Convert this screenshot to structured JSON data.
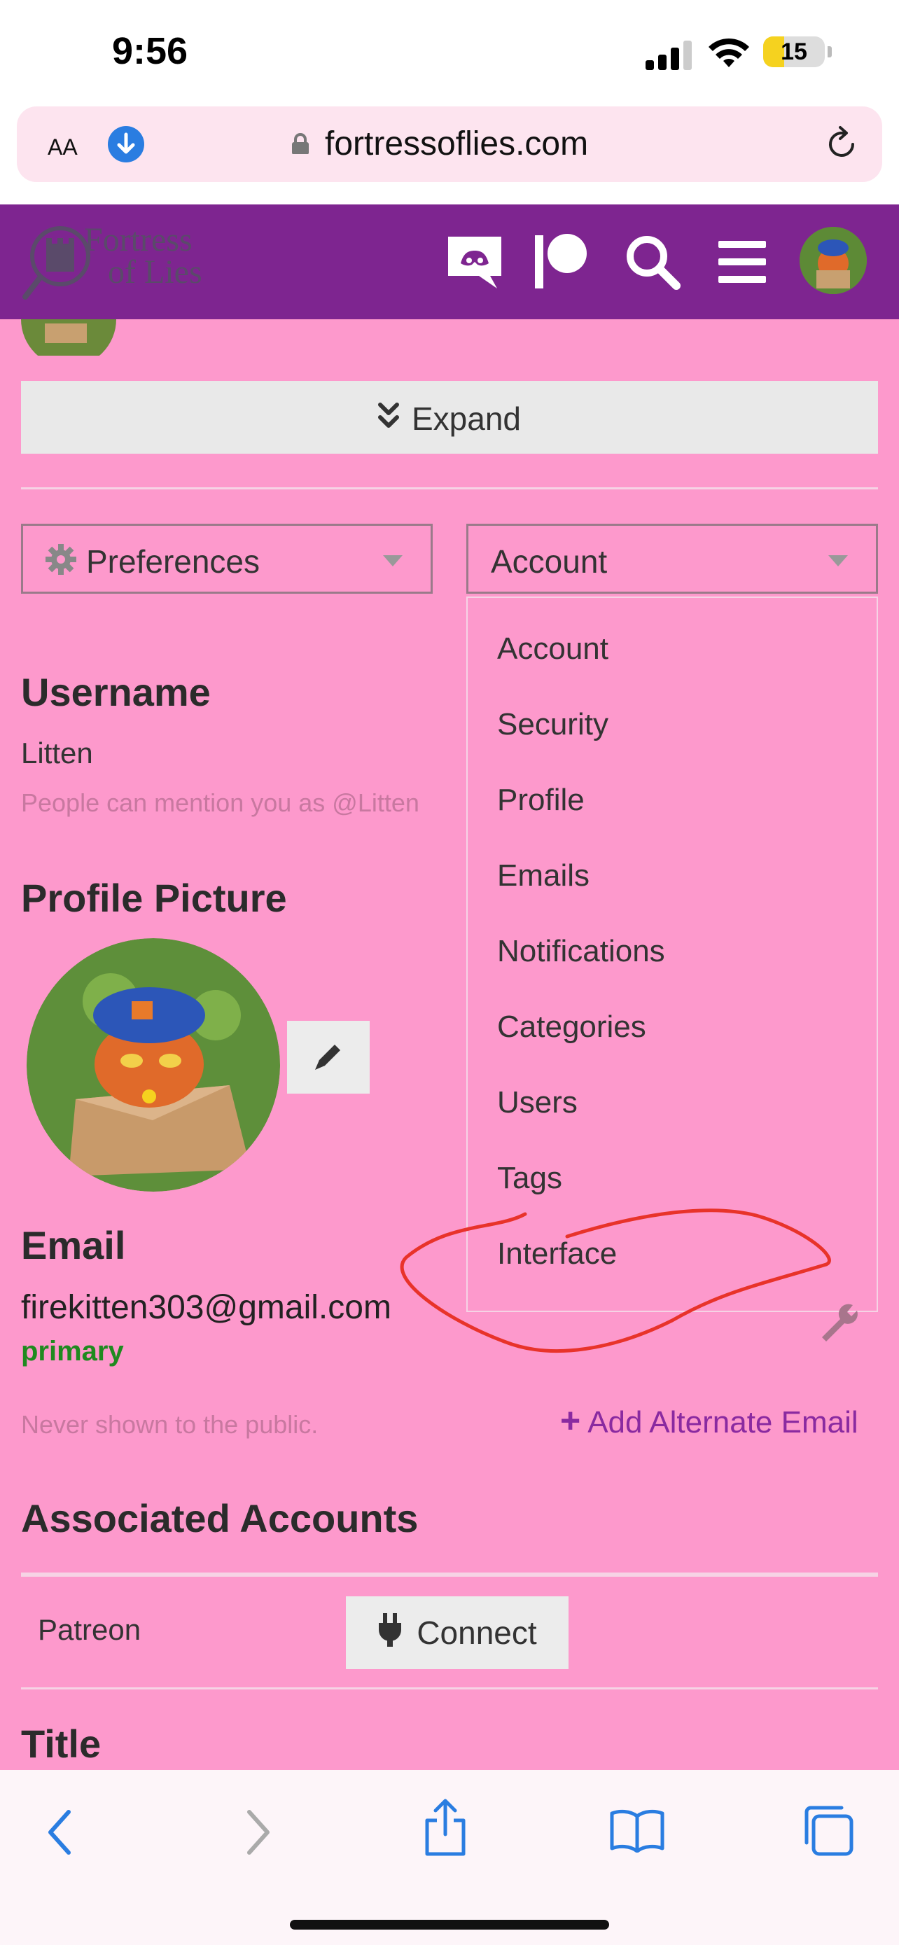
{
  "status_bar": {
    "time": "9:56",
    "battery": "15"
  },
  "browser": {
    "text_size_label": "AA",
    "url": "fortressoflies.com"
  },
  "site_header": {
    "logo_text_line1": "Fortress",
    "logo_text_line2": "of Lies",
    "icons": [
      "discord-icon",
      "patreon-icon",
      "search-icon",
      "hamburger-menu-icon",
      "user-avatar"
    ],
    "background_color": "#7e2590"
  },
  "page": {
    "expand_label": "Expand",
    "preferences_select_label": "Preferences",
    "account_select_label": "Account",
    "dropdown_items": [
      "Account",
      "Security",
      "Profile",
      "Emails",
      "Notifications",
      "Categories",
      "Users",
      "Tags",
      "Interface"
    ],
    "username_heading": "Username",
    "username_value": "Litten",
    "username_hint": "People can mention you as @Litten",
    "profile_picture_heading": "Profile Picture",
    "email_heading": "Email",
    "email_value": "firekitten303@gmail.com",
    "email_primary_label": "primary",
    "email_hint": "Never shown to the public.",
    "add_alternate_email": "Add Alternate Email",
    "associated_accounts_heading": "Associated Accounts",
    "patreon_label": "Patreon",
    "connect_label": "Connect",
    "title_heading": "Title",
    "background_color": "#fd99cc",
    "annotation_color": "#e8332a"
  }
}
